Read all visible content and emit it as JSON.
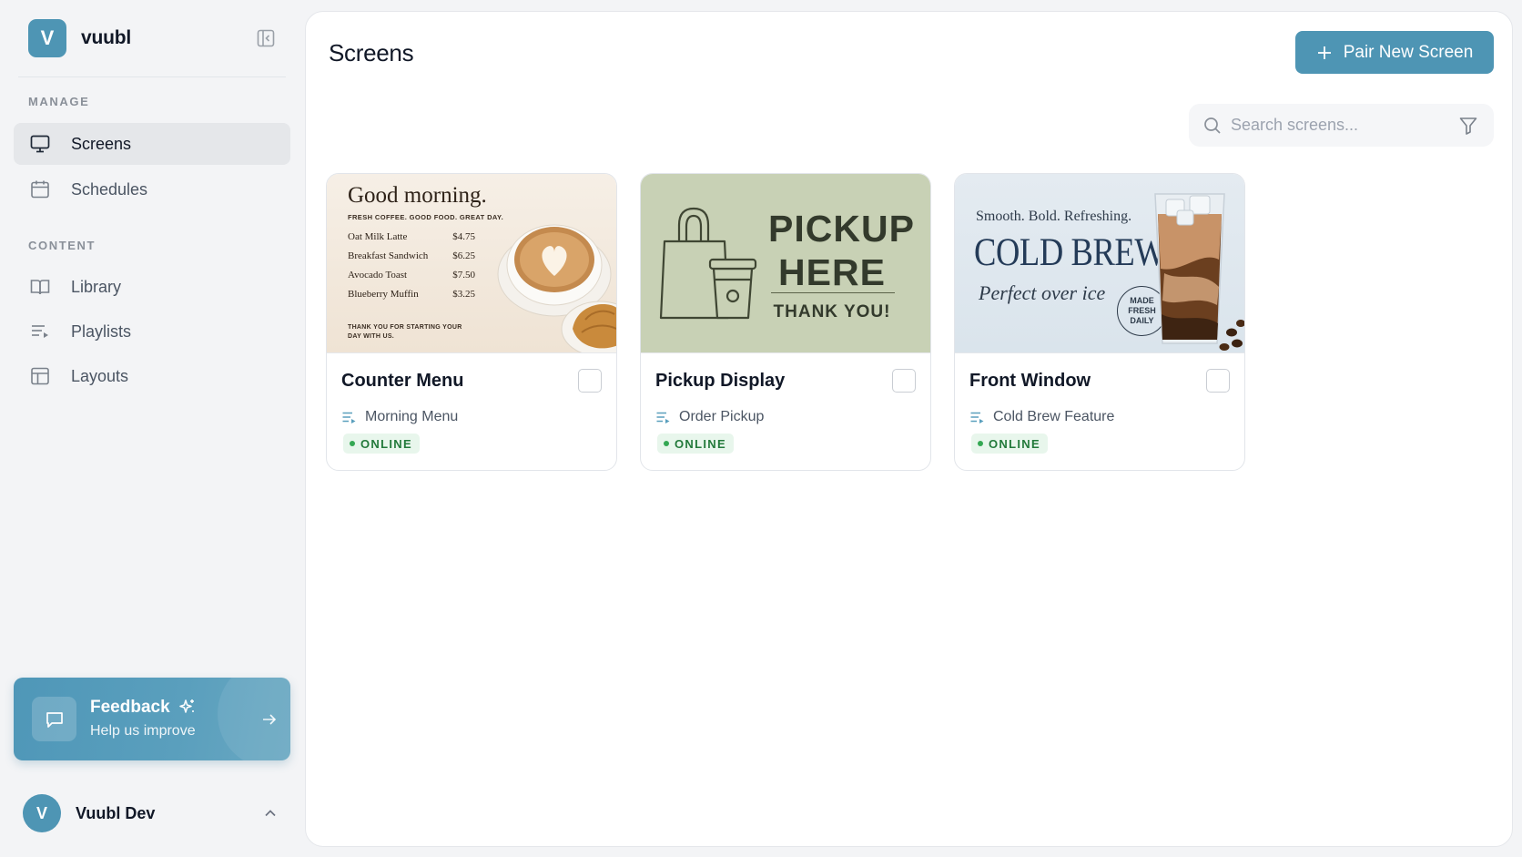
{
  "brand": {
    "initial": "V",
    "name": "vuubl"
  },
  "sidebar": {
    "sections": [
      {
        "label": "MANAGE"
      },
      {
        "label": "CONTENT"
      }
    ],
    "items": [
      {
        "label": "Screens",
        "icon": "monitor-icon",
        "active": true
      },
      {
        "label": "Schedules",
        "icon": "calendar-icon"
      },
      {
        "label": "Library",
        "icon": "book-icon"
      },
      {
        "label": "Playlists",
        "icon": "playlist-icon"
      },
      {
        "label": "Layouts",
        "icon": "layout-icon"
      }
    ],
    "feedback": {
      "title": "Feedback",
      "subtitle": "Help us improve"
    },
    "user": {
      "initial": "V",
      "name": "Vuubl Dev"
    }
  },
  "main": {
    "title": "Screens",
    "pair_button": "Pair New Screen",
    "search": {
      "placeholder": "Search screens..."
    }
  },
  "screens": [
    {
      "name": "Counter Menu",
      "playlist": "Morning Menu",
      "status": "ONLINE",
      "thumbnail": {
        "title": "Good morning.",
        "subtitle": "FRESH COFFEE. GOOD FOOD. GREAT DAY.",
        "menu": [
          {
            "item": "Oat Milk Latte",
            "price": "$4.75"
          },
          {
            "item": "Breakfast Sandwich",
            "price": "$6.25"
          },
          {
            "item": "Avocado Toast",
            "price": "$7.50"
          },
          {
            "item": "Blueberry Muffin",
            "price": "$3.25"
          }
        ],
        "footer": "THANK YOU FOR STARTING YOUR DAY WITH US."
      }
    },
    {
      "name": "Pickup Display",
      "playlist": "Order Pickup",
      "status": "ONLINE",
      "thumbnail": {
        "title_line1": "PICKUP",
        "title_line2": "HERE",
        "subtitle": "THANK YOU!"
      }
    },
    {
      "name": "Front Window",
      "playlist": "Cold Brew Feature",
      "status": "ONLINE",
      "thumbnail": {
        "top": "Smooth. Bold. Refreshing.",
        "title": "COLD BREW",
        "subtitle": "Perfect over ice",
        "badge_line1": "MADE",
        "badge_line2": "FRESH",
        "badge_line3": "DAILY"
      }
    }
  ],
  "colors": {
    "accent": "#4e95b4",
    "online_bg": "#e8f6ec",
    "online_text": "#237a3b",
    "online_dot": "#34a853"
  }
}
